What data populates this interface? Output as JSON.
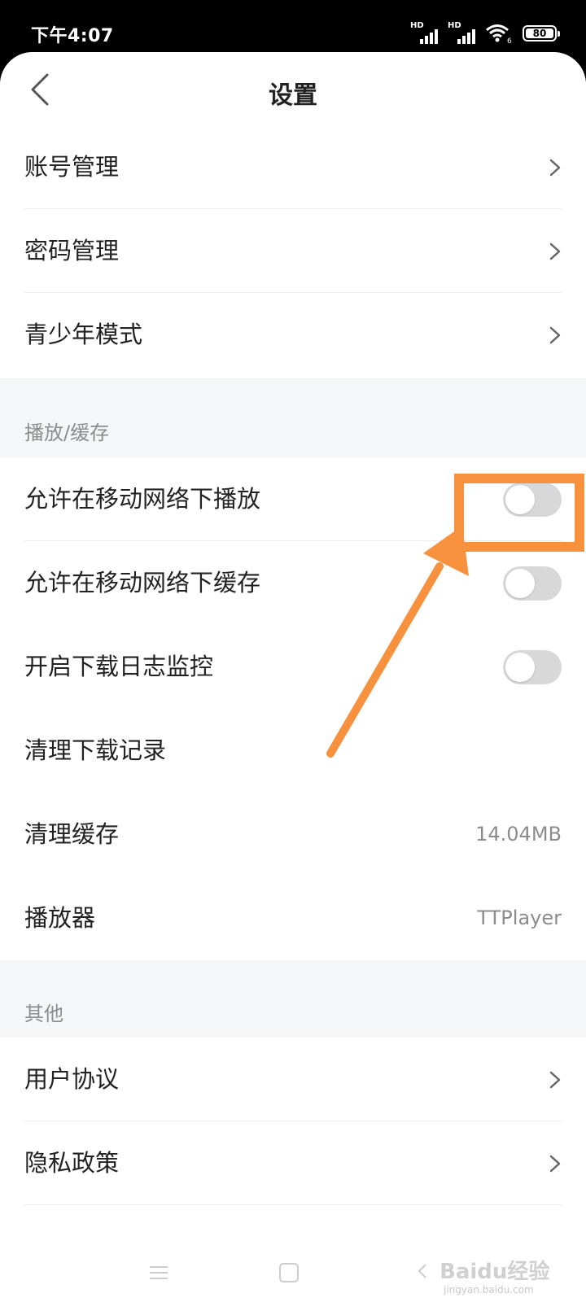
{
  "status_bar": {
    "time": "下午4:07",
    "signal1_label": "HD",
    "signal2_label": "HD",
    "wifi_badge": "6",
    "battery_level": "80"
  },
  "nav": {
    "title": "设置",
    "back_icon": "back-arrow-icon"
  },
  "account_group": [
    {
      "label": "账号管理",
      "icon": "chevron-right-icon"
    },
    {
      "label": "密码管理",
      "icon": "chevron-right-icon"
    },
    {
      "label": "青少年模式",
      "icon": "chevron-right-icon"
    }
  ],
  "play_cache": {
    "section_title": "播放/缓存",
    "rows": [
      {
        "label": "允许在移动网络下播放",
        "toggle_on": false
      },
      {
        "label": "允许在移动网络下缓存",
        "toggle_on": false
      },
      {
        "label": "开启下载日志监控",
        "toggle_on": false
      },
      {
        "label": "清理下载记录"
      },
      {
        "label": "清理缓存",
        "value": "14.04MB"
      },
      {
        "label": "播放器",
        "value": "TTPlayer"
      }
    ]
  },
  "other": {
    "section_title": "其他",
    "rows": [
      {
        "label": "用户协议",
        "icon": "chevron-right-icon"
      },
      {
        "label": "隐私政策",
        "icon": "chevron-right-icon"
      }
    ]
  },
  "annotation": {
    "color": "#f7913d"
  },
  "watermark": {
    "text": "Baidu经验",
    "sub": "jingyan.baidu.com"
  }
}
